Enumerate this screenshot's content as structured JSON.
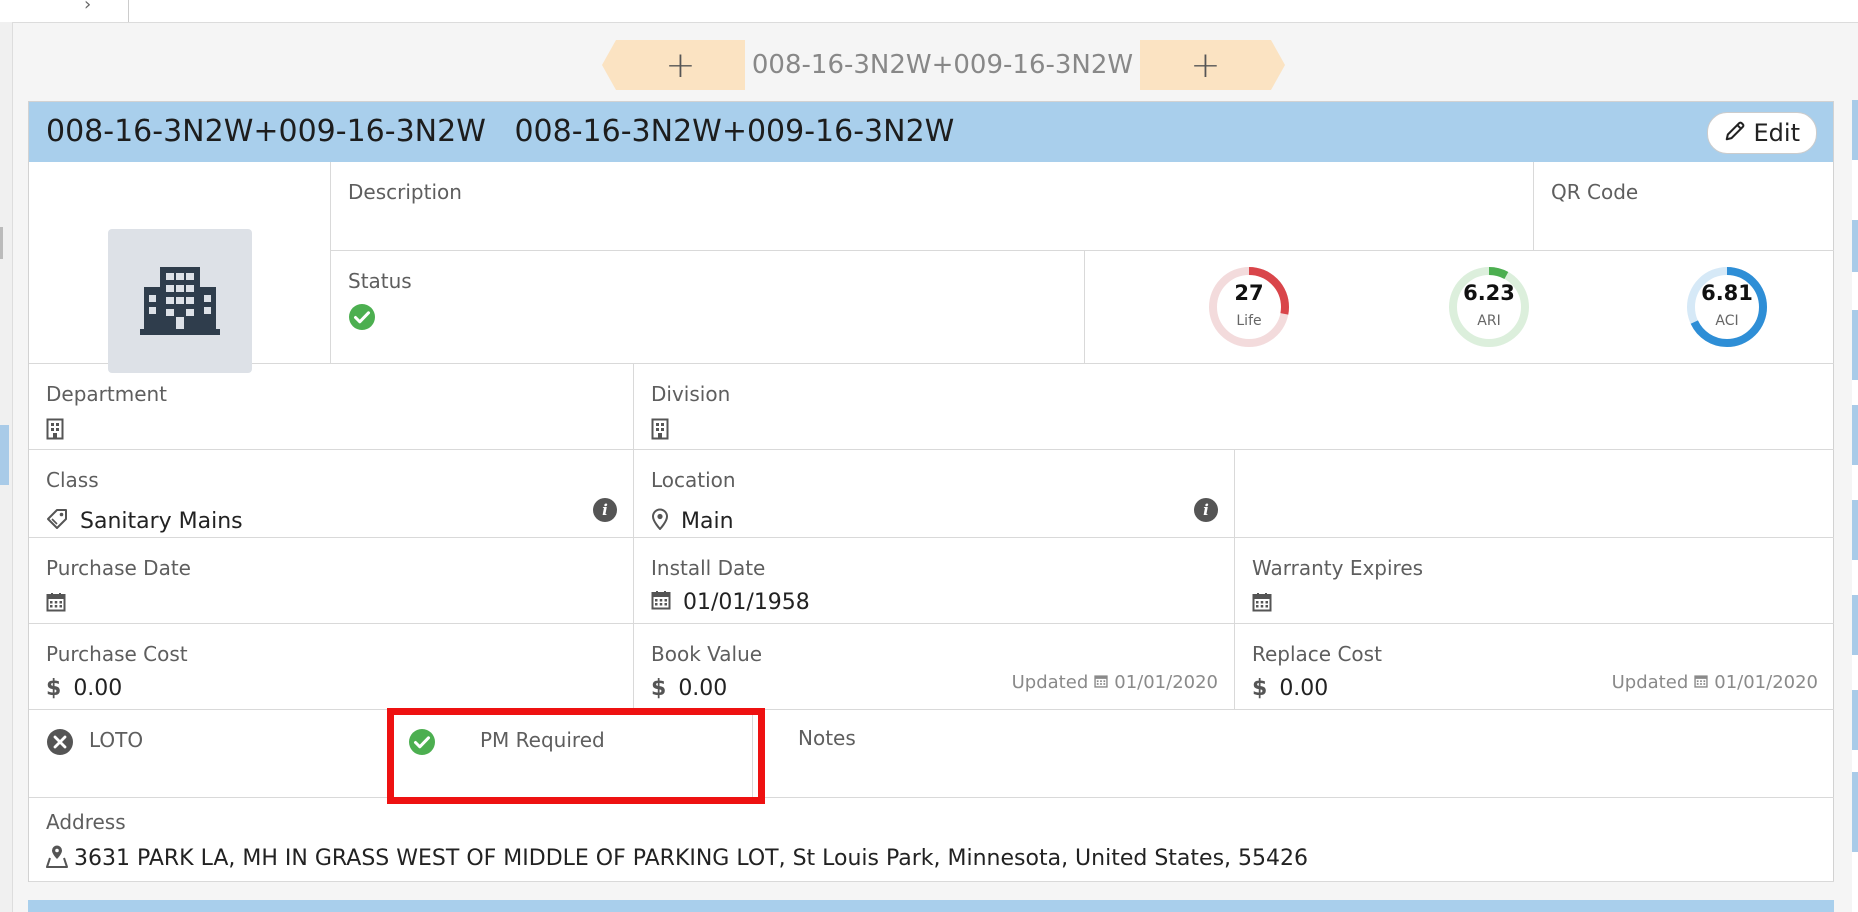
{
  "nav": {
    "prev_label": "+",
    "next_label": "+",
    "current": "008-16-3N2W+009-16-3N2W"
  },
  "header": {
    "title": "008-16-3N2W+009-16-3N2W   008-16-3N2W+009-16-3N2W",
    "edit_label": "Edit"
  },
  "fields": {
    "description_label": "Description",
    "qr_label": "QR Code",
    "status_label": "Status",
    "department_label": "Department",
    "division_label": "Division",
    "class_label": "Class",
    "class_value": "Sanitary Mains",
    "location_label": "Location",
    "location_value": "Main",
    "purchase_date_label": "Purchase Date",
    "install_date_label": "Install Date",
    "install_date_value": "01/01/1958",
    "warranty_label": "Warranty Expires",
    "purchase_cost_label": "Purchase Cost",
    "purchase_cost_value": "0.00",
    "book_value_label": "Book Value",
    "book_value_value": "0.00",
    "book_value_updated_label": "Updated",
    "book_value_updated_date": "01/01/2020",
    "replace_cost_label": "Replace Cost",
    "replace_cost_value": "0.00",
    "replace_cost_updated_label": "Updated",
    "replace_cost_updated_date": "01/01/2020",
    "currency_symbol": "$",
    "loto_label": "LOTO",
    "pm_required_label": "PM Required",
    "notes_label": "Notes",
    "address_label": "Address",
    "address_value": "3631 PARK LA, MH IN GRASS WEST OF MIDDLE OF PARKING LOT, St Louis Park, Minnesota, United States, 55426"
  },
  "gauges": [
    {
      "value": "27",
      "caption": "Life",
      "fraction": 0.28,
      "color": "#d9454a",
      "track": "#f3dbdc"
    },
    {
      "value": "6.23",
      "caption": "ARI",
      "fraction": 0.08,
      "color": "#4caf50",
      "track": "#dcefdc"
    },
    {
      "value": "6.81",
      "caption": "ACI",
      "fraction": 0.68,
      "color": "#2e8ed6",
      "track": "#d6e9f7"
    }
  ],
  "colors": {
    "header": "#a9cfec",
    "nav": "#fbe3c2",
    "check": "#4caf50",
    "highlight": "#ee1111"
  },
  "icons": {
    "thumbnail": "building-icon",
    "edit": "pencil-icon",
    "status": "check-circle-icon",
    "department": "office-building-icon",
    "division": "office-building-icon",
    "class": "tag-icon",
    "location": "map-pin-icon",
    "info": "info-icon",
    "date": "calendar-icon",
    "currency": "dollar-icon",
    "loto": "x-circle-icon",
    "pm_required": "check-circle-icon",
    "address": "map-marker-icon"
  }
}
